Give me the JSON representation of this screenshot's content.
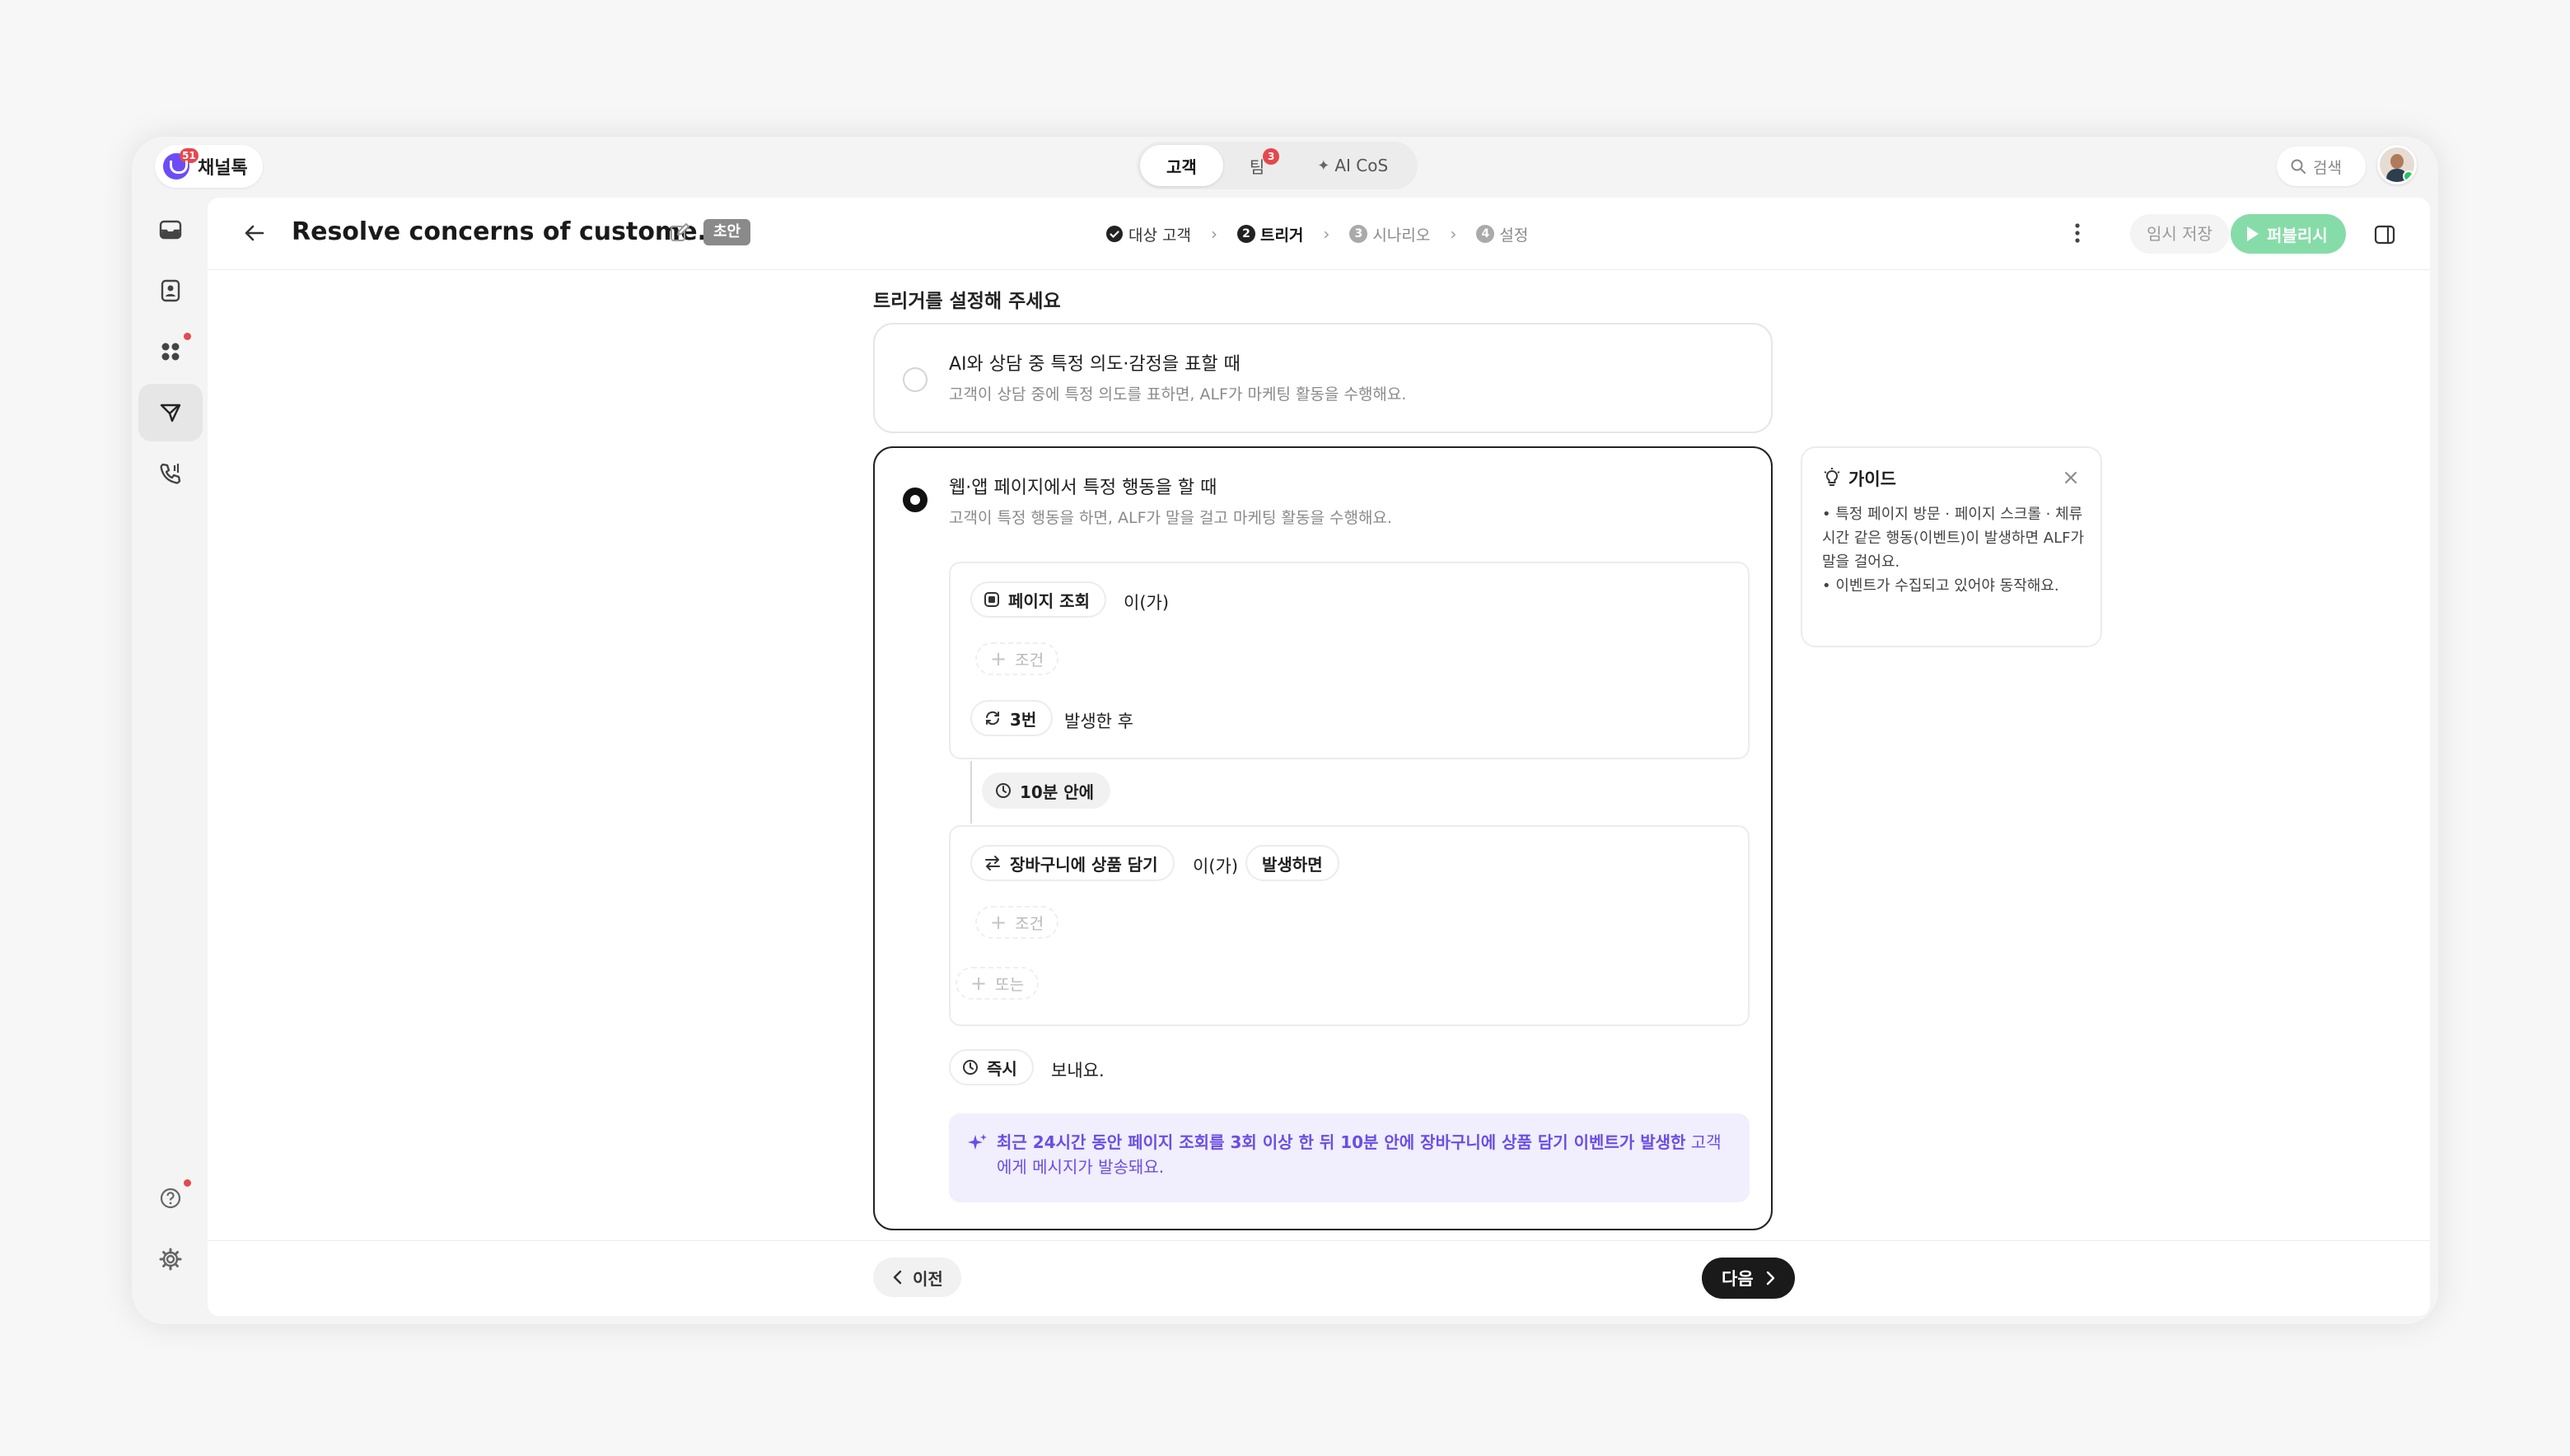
{
  "brand": {
    "name": "채널톡",
    "badge": "51"
  },
  "center_tabs": [
    {
      "label": "고객",
      "active": true
    },
    {
      "label": "팀",
      "badge": "3"
    },
    {
      "label": "AI CoS"
    }
  ],
  "search": {
    "label": "검색"
  },
  "header": {
    "title": "Resolve concerns of custome...",
    "status_badge": "초안",
    "steps": [
      {
        "label": "대상 고객",
        "state": "done"
      },
      {
        "label": "트리거",
        "num": "2",
        "state": "current"
      },
      {
        "label": "시나리오",
        "num": "3",
        "state": "todo"
      },
      {
        "label": "설정",
        "num": "4",
        "state": "todo"
      }
    ],
    "save_label": "임시 저장",
    "publish_label": "퍼블리시"
  },
  "content": {
    "title": "트리거를 설정해 주세요",
    "option1": {
      "title": "AI와 상담 중 특정 의도·감정을 표할 때",
      "desc": "고객이 상담 중에 특정 의도를 표하면, ALF가 마케팅 활동을 수행해요."
    },
    "option2": {
      "title": "웹·앱 페이지에서 특정 행동을 할 때",
      "desc": "고객이 특정 행동을 하면, ALF가 말을 걸고 마케팅 활동을 수행해요.",
      "event1": "페이지 조회",
      "subject_particle": "이(가)",
      "add_condition": "조건",
      "count": "3번",
      "after_text": "발생한 후",
      "within": "10분 안에",
      "event2": "장바구니에 상품 담기",
      "occur": "발생하면",
      "or_label": "또는",
      "timing": "즉시",
      "send_text": "보내요.",
      "summary_bold": "최근 24시간 동안 페이지 조회를 3회 이상 한 뒤 10분 안에 장바구니에 상품 담기 이벤트가 발생한",
      "summary_rest": " 고객에게 메시지가 발송돼요."
    }
  },
  "guide": {
    "title": "가이드",
    "line1": "• 특정 페이지 방문 · 페이지 스크롤 · 체류 시간 같은 행동(이벤트)이 발생하면 ALF가 말을 걸어요.",
    "line2": "• 이벤트가 수집되고 있어야 동작해요."
  },
  "footer": {
    "prev_label": "이전",
    "next_label": "다음"
  },
  "colors": {
    "accent": "#6c4cf6",
    "publish": "#86dca8",
    "summary_bg": "#f1eefe",
    "summary_text": "#6a4ee6",
    "badge": "#e5484d"
  }
}
